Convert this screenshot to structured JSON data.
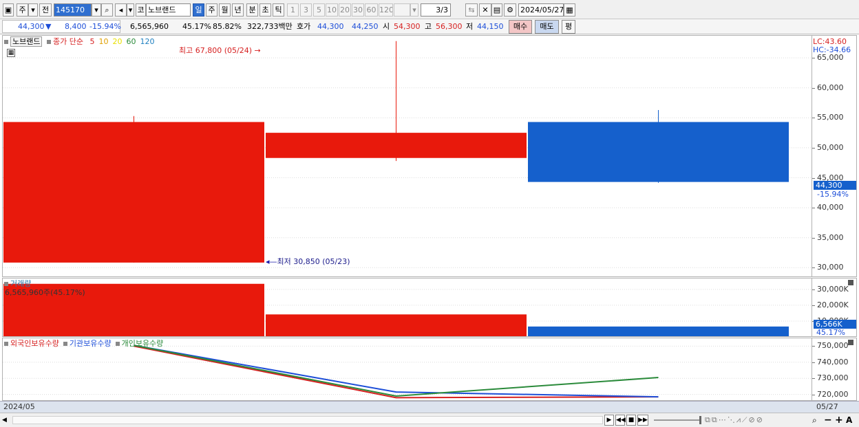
{
  "toolbar": {
    "market_selector": "주",
    "prev_label": "전",
    "stock_code": "145170",
    "market_tag": "코",
    "stock_name": "노브랜드",
    "periods": [
      "일",
      "주",
      "월",
      "년",
      "분",
      "초",
      "틱"
    ],
    "active_period": "일",
    "intervals": [
      "1",
      "3",
      "5",
      "10",
      "20",
      "30",
      "60",
      "120"
    ],
    "count_input": "3/3",
    "date_input": "2024/05/27"
  },
  "quote": {
    "price": "44,300",
    "change_arrow": "▼",
    "change": "8,400",
    "change_pct": "-15.94%",
    "volume": "6,565,960",
    "turnover_pct": "45.17%",
    "strength_pct": "85.82%",
    "trade_value": "322,733백만",
    "bid_label": "호가",
    "bid1": "44,300",
    "bid2": "44,250",
    "open_label": "시",
    "open": "54,300",
    "high_label": "고",
    "high": "56,300",
    "low_label": "저",
    "low": "44,150",
    "buy_button": "매수",
    "sell_button": "매도",
    "avg_button": "평"
  },
  "price_pane": {
    "stock_tag": "노브랜드",
    "legend_prefix": "종가 단순",
    "ma_periods": [
      {
        "label": "5",
        "color": "#d62020"
      },
      {
        "label": "10",
        "color": "#e0a000"
      },
      {
        "label": "20",
        "color": "#e8e000"
      },
      {
        "label": "60",
        "color": "#2a8a3a"
      },
      {
        "label": "120",
        "color": "#1d7fc0"
      }
    ],
    "max_annotation": "최고 67,800 (05/24)",
    "min_annotation": "최저 30,850 (05/23)",
    "lc_label": "LC:43.60",
    "hc_label": "HC:-34.66",
    "current_price_tag": "44,300",
    "current_pct_tag": "-15.94%",
    "y_ticks": [
      "65,000",
      "60,000",
      "55,000",
      "50,000",
      "45,000",
      "40,000",
      "35,000",
      "30,000"
    ]
  },
  "volume_pane": {
    "title": "거래량",
    "info": "6,565,960주(45.17%)",
    "y_ticks": [
      "30,000K",
      "20,000K",
      "10,000K"
    ],
    "current_tag": "6,566K",
    "current_pct": "45.17%"
  },
  "holdings_pane": {
    "legend": [
      {
        "label": "외국인보유수량",
        "color": "#d62020"
      },
      {
        "label": "기관보유수량",
        "color": "#1d4ed8"
      },
      {
        "label": "개인보유수량",
        "color": "#2a8a3a"
      }
    ],
    "y_ticks": [
      "750,000",
      "740,000",
      "730,000",
      "720,000"
    ]
  },
  "time_axis": {
    "left_label": "2024/05",
    "right_label": "05/27"
  },
  "chart_data": [
    {
      "type": "candlestick",
      "dates": [
        "05/23",
        "05/24",
        "05/27"
      ],
      "open": [
        30850,
        52500,
        54300
      ],
      "high": [
        55300,
        67800,
        56300
      ],
      "low": [
        30850,
        47800,
        44150
      ],
      "close": [
        54300,
        48300,
        44300
      ],
      "colors": [
        "#e8190c",
        "#e8190c",
        "#1560cc"
      ],
      "ylim": [
        29000,
        68000
      ]
    },
    {
      "type": "bar",
      "title": "거래량",
      "categories": [
        "05/23",
        "05/24",
        "05/27"
      ],
      "values": [
        33500000,
        14200000,
        6565960
      ],
      "colors": [
        "#e8190c",
        "#e8190c",
        "#1560cc"
      ],
      "ylim": [
        0,
        36000000
      ]
    },
    {
      "type": "line",
      "categories": [
        "05/23",
        "05/24",
        "05/27"
      ],
      "series": [
        {
          "name": "외국인보유수량",
          "color": "#d62020",
          "values": [
            750000,
            718000,
            718500
          ]
        },
        {
          "name": "기관보유수량",
          "color": "#1d4ed8",
          "values": [
            750500,
            721500,
            718500
          ]
        },
        {
          "name": "개인보유수량",
          "color": "#2a8a3a",
          "values": [
            750500,
            719000,
            730500
          ]
        }
      ],
      "ylim": [
        716000,
        754000
      ]
    }
  ]
}
